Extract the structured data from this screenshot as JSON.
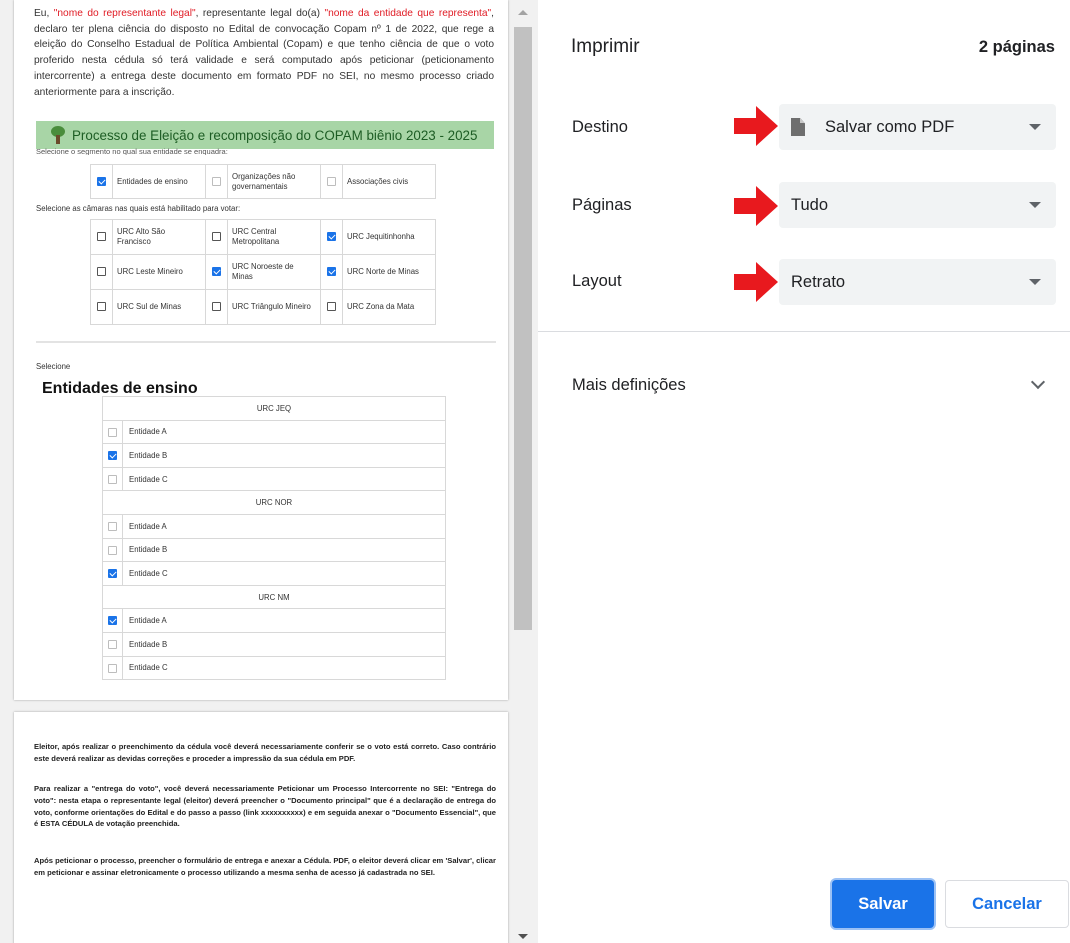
{
  "preview": {
    "intro_parts": {
      "p1": "Eu, ",
      "rep_name": "\"nome do representante legal\"",
      "p2": ", representante legal do(a) ",
      "entity_name": "\"nome da entidade que representa\"",
      "p3": ", declaro ter plena ciência do disposto no Edital de convocação Copam nº 1 de 2022, que rege a eleição do Conselho Estadual de Política Ambiental (Copam) e que tenho ciência de que o voto proferido nesta cédula só terá validade e será computado após peticionar (peticionamento intercorrente) a entrega deste documento em formato PDF no SEI, no mesmo processo criado anteriormente para a inscrição."
    },
    "banner": "Processo de Eleição e recomposição do COPAM biênio 2023 - 2025",
    "segment_hint": "Selecione o segmento no qual sua entidade se enquadra:",
    "segments": [
      {
        "label": "Entidades de ensino",
        "checked": true
      },
      {
        "label": "Organizações não governamentais",
        "checked": false
      },
      {
        "label": "Associações civis",
        "checked": false
      }
    ],
    "chambers_hint": "Selecione as câmaras nas quais está habilitado para votar:",
    "chambers": [
      {
        "label": "URC Alto São Francisco",
        "checked": false
      },
      {
        "label": "URC Central Metropolitana",
        "checked": false
      },
      {
        "label": "URC Jequitinhonha",
        "checked": true
      },
      {
        "label": "URC Leste Mineiro",
        "checked": false
      },
      {
        "label": "URC Noroeste de Minas",
        "checked": true
      },
      {
        "label": "URC Norte de Minas",
        "checked": true
      },
      {
        "label": "URC Sul de Minas",
        "checked": false
      },
      {
        "label": "URC Triângulo Mineiro",
        "checked": false
      },
      {
        "label": "URC Zona da Mata",
        "checked": false
      }
    ],
    "select_label": "Selecione",
    "entities_title": "Entidades de ensino",
    "groups": [
      {
        "name": "URC JEQ",
        "items": [
          {
            "label": "Entidade A",
            "checked": false
          },
          {
            "label": "Entidade B",
            "checked": true
          },
          {
            "label": "Entidade C",
            "checked": false
          }
        ]
      },
      {
        "name": "URC NOR",
        "items": [
          {
            "label": "Entidade A",
            "checked": false
          },
          {
            "label": "Entidade B",
            "checked": false
          },
          {
            "label": "Entidade C",
            "checked": true
          }
        ]
      },
      {
        "name": "URC NM",
        "items": [
          {
            "label": "Entidade A",
            "checked": true
          },
          {
            "label": "Entidade B",
            "checked": false
          },
          {
            "label": "Entidade C",
            "checked": false
          }
        ]
      }
    ],
    "page2": {
      "para1": "Eleitor, após realizar o preenchimento da cédula você deverá necessariamente conferir se o voto está correto. Caso contrário este deverá realizar as devidas correções e proceder a impressão da sua cédula em PDF.",
      "para2": "Para realizar a \"entrega do voto\", você deverá necessariamente Peticionar um Processo Intercorrente no SEI: \"Entrega do voto\": nesta etapa o representante legal (eleitor) deverá preencher o \"Documento principal\" que é a declaração de entrega do voto, conforme orientações do Edital e do passo a passo (link xxxxxxxxxx) e em seguida anexar o \"Documento Essencial\", que é ESTA CÉDULA de votação preenchida.",
      "para3": "Após peticionar o processo, preencher o formulário de entrega e anexar a Cédula. PDF, o eleitor deverá clicar em 'Salvar', clicar em peticionar e assinar eletronicamente o processo utilizando a mesma senha de acesso já cadastrada no SEI."
    }
  },
  "settings": {
    "title": "Imprimir",
    "page_count": "2 páginas",
    "destination_label": "Destino",
    "destination_value": "Salvar como PDF",
    "pages_label": "Páginas",
    "pages_value": "Tudo",
    "layout_label": "Layout",
    "layout_value": "Retrato",
    "more_settings": "Mais definições",
    "save_button": "Salvar",
    "cancel_button": "Cancelar"
  },
  "colors": {
    "accent": "#1a73e8",
    "arrow_red": "#e8191e",
    "banner_green": "#a8d5a6",
    "highlight_red": "#e01b24"
  },
  "icons": [
    "document-icon",
    "dropdown-caret-icon",
    "chevron-down-icon",
    "red-arrow-icon",
    "tree-logo-icon",
    "checkbox-icon"
  ]
}
